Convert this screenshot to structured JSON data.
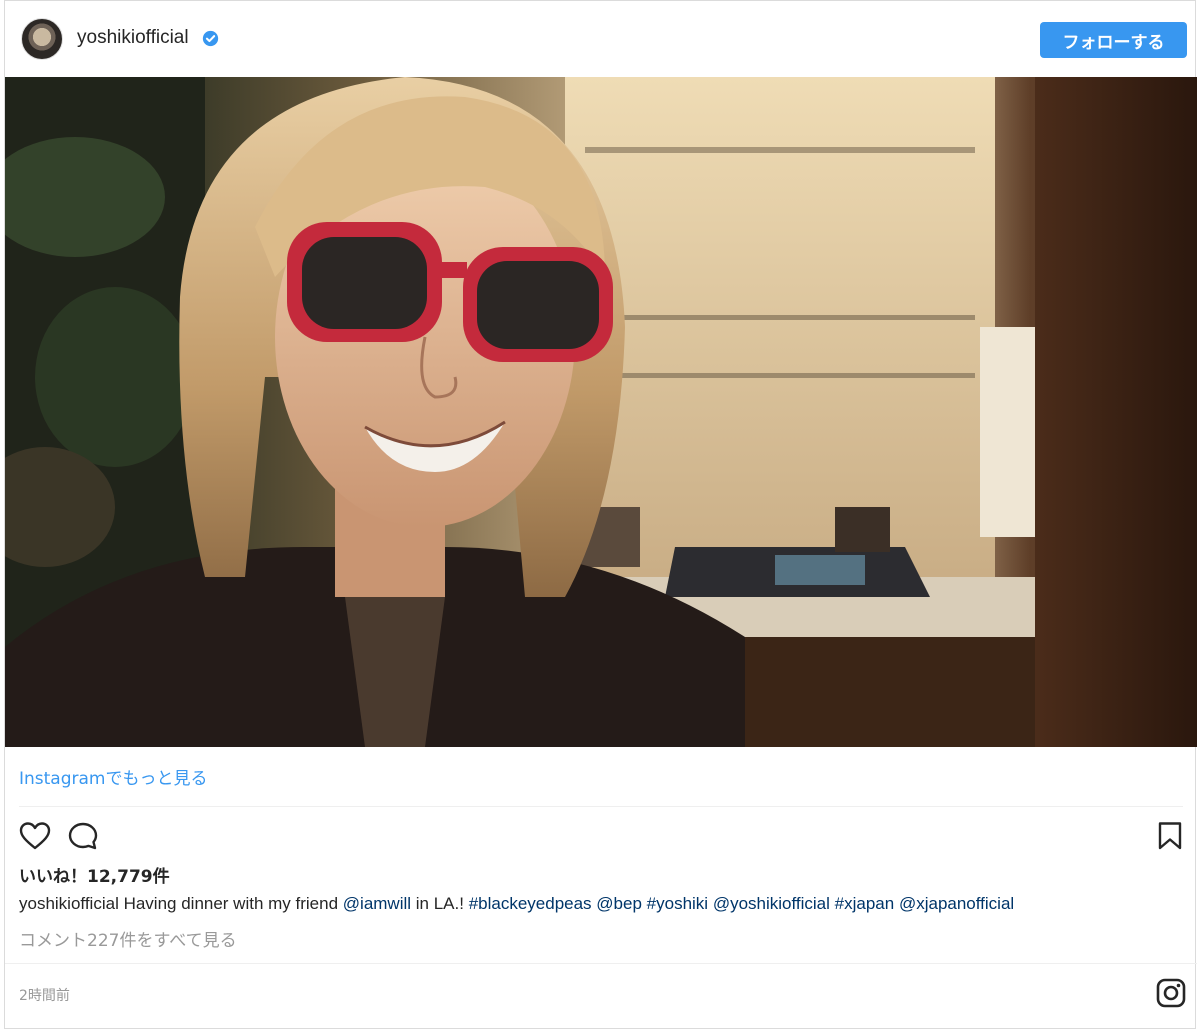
{
  "header": {
    "username": "yoshikiofficial",
    "follow_label": "フォローする"
  },
  "photo": {
    "alt": "Selfie of a man with shoulder-length blond hair and red-framed sunglasses in a restaurant"
  },
  "more_link": "Instagramでもっと見る",
  "likes": "いいね！12,779件",
  "caption": {
    "username": "yoshikiofficial",
    "text_1": " Having dinner with my friend ",
    "mention_1": "@iamwill",
    "text_2": " in LA.! ",
    "tag_1": "#blackeyedpeas",
    "space_1": " ",
    "mention_2": "@bep",
    "space_2": " ",
    "tag_2": "#yoshiki",
    "space_3": " ",
    "mention_3": "@yoshikiofficial",
    "space_4": " ",
    "tag_3": "#xjapan",
    "space_5": " ",
    "mention_4": "@xjapanofficial"
  },
  "comments_link": "コメント227件をすべて見る",
  "timestamp": "2時間前",
  "colors": {
    "accent": "#3897f0",
    "link": "#003569",
    "muted": "#999999",
    "text": "#262626"
  },
  "icons": [
    "heart-icon",
    "comment-icon",
    "bookmark-icon",
    "instagram-icon",
    "verified-badge-icon"
  ]
}
